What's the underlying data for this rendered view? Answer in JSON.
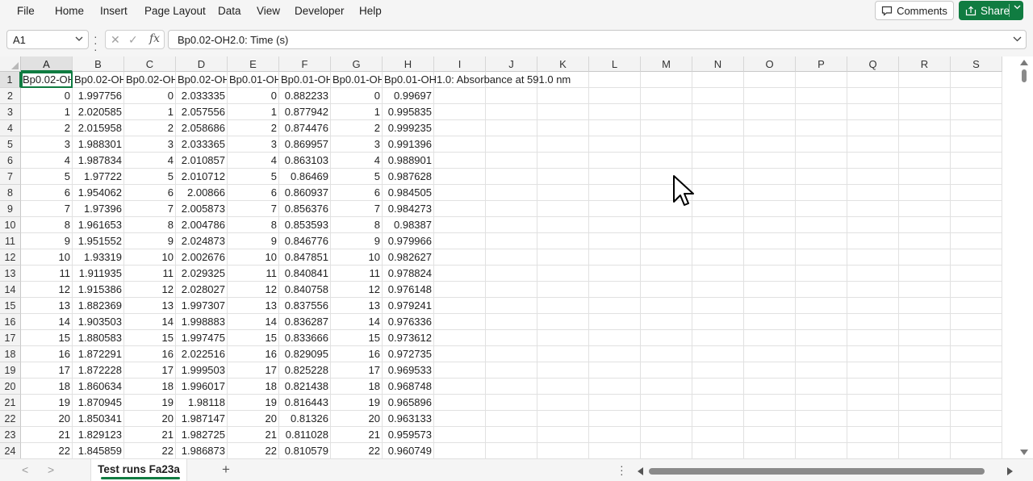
{
  "menu": [
    "File",
    "Home",
    "Insert",
    "Page Layout",
    "Data",
    "View",
    "Developer",
    "Help"
  ],
  "comments_label": "Comments",
  "share_label": "Share",
  "name_box": "A1",
  "formula_text": "Bp0.02-OH2.0: Time (s)",
  "columns": [
    "A",
    "B",
    "C",
    "D",
    "E",
    "F",
    "G",
    "H",
    "I",
    "J",
    "K",
    "L",
    "M",
    "N",
    "O",
    "P",
    "Q",
    "R",
    "S"
  ],
  "row_numbers": [
    "1",
    "2",
    "3",
    "4",
    "5",
    "6",
    "7",
    "8",
    "9",
    "10",
    "11",
    "12",
    "13",
    "14",
    "15",
    "16",
    "17",
    "18",
    "19",
    "20",
    "21",
    "22",
    "23",
    "24"
  ],
  "header_row": [
    "Bp0.02-OH",
    "Bp0.02-OH",
    "Bp0.02-OH",
    "Bp0.02-OH",
    "Bp0.01-OH",
    "Bp0.01-OH",
    "Bp0.01-OH",
    "Bp0.01-OH1.0: Absorbance at 591.0 nm"
  ],
  "rows": [
    [
      "0",
      "1.997756",
      "0",
      "2.033335",
      "0",
      "0.882233",
      "0",
      "0.99697"
    ],
    [
      "1",
      "2.020585",
      "1",
      "2.057556",
      "1",
      "0.877942",
      "1",
      "0.995835"
    ],
    [
      "2",
      "2.015958",
      "2",
      "2.058686",
      "2",
      "0.874476",
      "2",
      "0.999235"
    ],
    [
      "3",
      "1.988301",
      "3",
      "2.033365",
      "3",
      "0.869957",
      "3",
      "0.991396"
    ],
    [
      "4",
      "1.987834",
      "4",
      "2.010857",
      "4",
      "0.863103",
      "4",
      "0.988901"
    ],
    [
      "5",
      "1.97722",
      "5",
      "2.010712",
      "5",
      "0.86469",
      "5",
      "0.987628"
    ],
    [
      "6",
      "1.954062",
      "6",
      "2.00866",
      "6",
      "0.860937",
      "6",
      "0.984505"
    ],
    [
      "7",
      "1.97396",
      "7",
      "2.005873",
      "7",
      "0.856376",
      "7",
      "0.984273"
    ],
    [
      "8",
      "1.961653",
      "8",
      "2.004786",
      "8",
      "0.853593",
      "8",
      "0.98387"
    ],
    [
      "9",
      "1.951552",
      "9",
      "2.024873",
      "9",
      "0.846776",
      "9",
      "0.979966"
    ],
    [
      "10",
      "1.93319",
      "10",
      "2.002676",
      "10",
      "0.847851",
      "10",
      "0.982627"
    ],
    [
      "11",
      "1.911935",
      "11",
      "2.029325",
      "11",
      "0.840841",
      "11",
      "0.978824"
    ],
    [
      "12",
      "1.915386",
      "12",
      "2.028027",
      "12",
      "0.840758",
      "12",
      "0.976148"
    ],
    [
      "13",
      "1.882369",
      "13",
      "1.997307",
      "13",
      "0.837556",
      "13",
      "0.979241"
    ],
    [
      "14",
      "1.903503",
      "14",
      "1.998883",
      "14",
      "0.836287",
      "14",
      "0.976336"
    ],
    [
      "15",
      "1.880583",
      "15",
      "1.997475",
      "15",
      "0.833666",
      "15",
      "0.973612"
    ],
    [
      "16",
      "1.872291",
      "16",
      "2.022516",
      "16",
      "0.829095",
      "16",
      "0.972735"
    ],
    [
      "17",
      "1.872228",
      "17",
      "1.999503",
      "17",
      "0.825228",
      "17",
      "0.969533"
    ],
    [
      "18",
      "1.860634",
      "18",
      "1.996017",
      "18",
      "0.821438",
      "18",
      "0.968748"
    ],
    [
      "19",
      "1.870945",
      "19",
      "1.98118",
      "19",
      "0.816443",
      "19",
      "0.965896"
    ],
    [
      "20",
      "1.850341",
      "20",
      "1.987147",
      "20",
      "0.81326",
      "20",
      "0.963133"
    ],
    [
      "21",
      "1.829123",
      "21",
      "1.982725",
      "21",
      "0.811028",
      "21",
      "0.959573"
    ],
    [
      "22",
      "1.845859",
      "22",
      "1.986873",
      "22",
      "0.810579",
      "22",
      "0.960749"
    ]
  ],
  "sheet_tab": "Test runs Fa23a",
  "add_sheet": "+",
  "accent_color": "#107c41"
}
